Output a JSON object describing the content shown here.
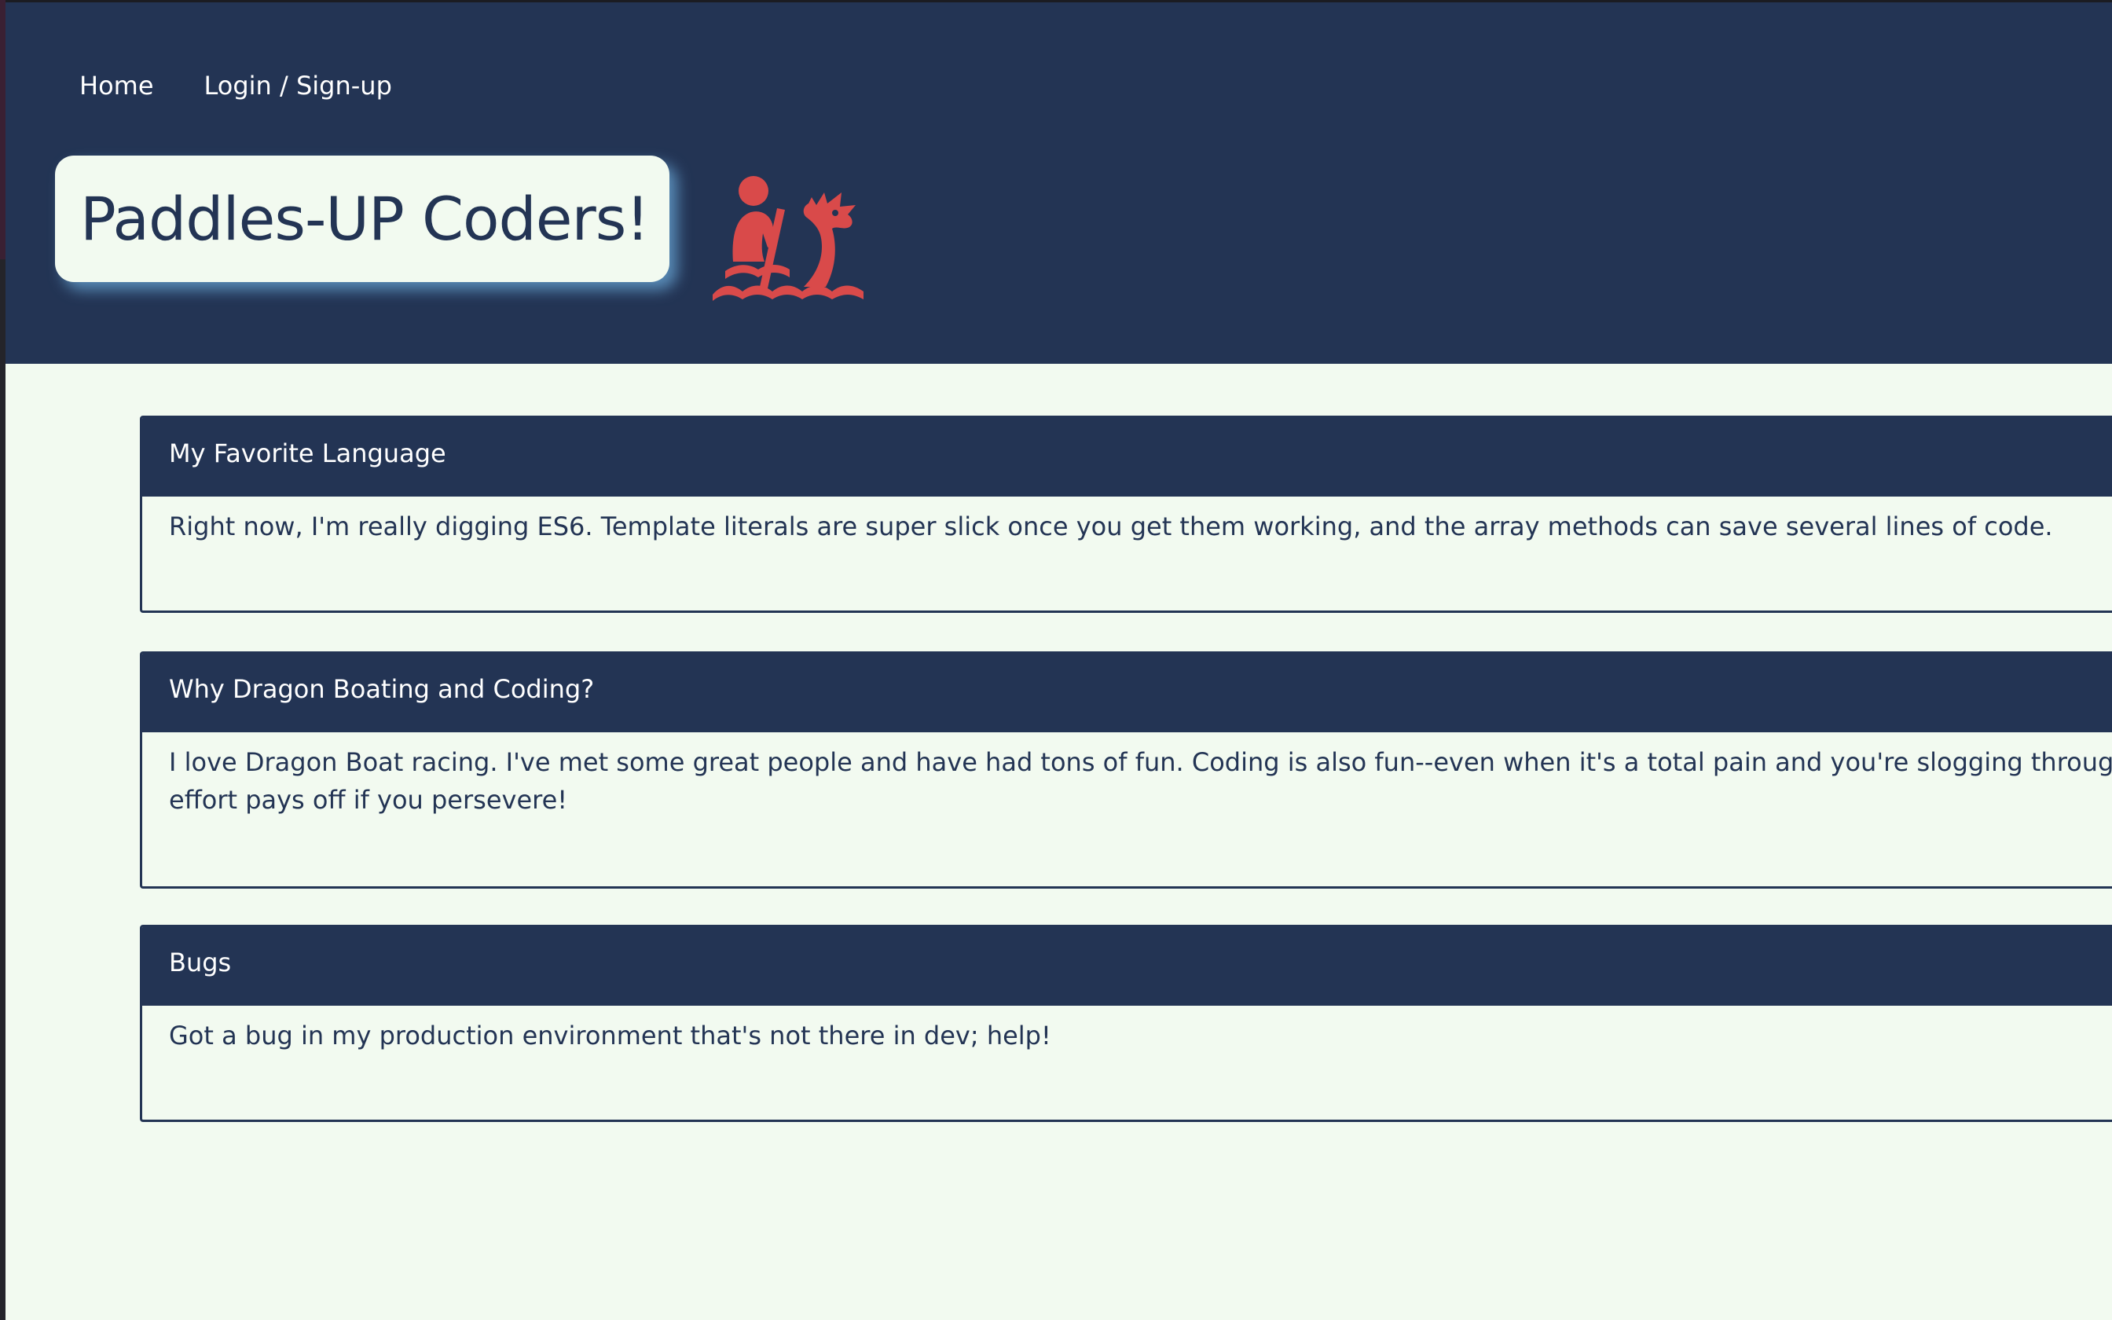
{
  "nav": {
    "home_label": "Home",
    "login_label": "Login / Sign-up"
  },
  "header": {
    "title": "Paddles-UP Coders!",
    "logo_icon": "dragon-boat-paddler-icon",
    "logo_color": "#d94a4a"
  },
  "colors": {
    "navy": "#233454",
    "background": "#f2faf0",
    "shadow": "#619ac8"
  },
  "posts": [
    {
      "title": "My Favorite Language",
      "body_lines": [
        "Right now, I'm really digging ES6. Template literals are super slick once you get them working, and the array methods can save several lines of code."
      ]
    },
    {
      "title": "Why Dragon Boating and Coding?",
      "body_lines": [
        "I love Dragon Boat racing. I've met some great people and have had tons of fun. Coding is also fun--even when it's a total pain and you're slogging through it saying \"why a",
        "effort pays off if you persevere!"
      ]
    },
    {
      "title": "Bugs",
      "body_lines": [
        "Got a bug in my production environment that's not there in dev; help!"
      ]
    }
  ]
}
